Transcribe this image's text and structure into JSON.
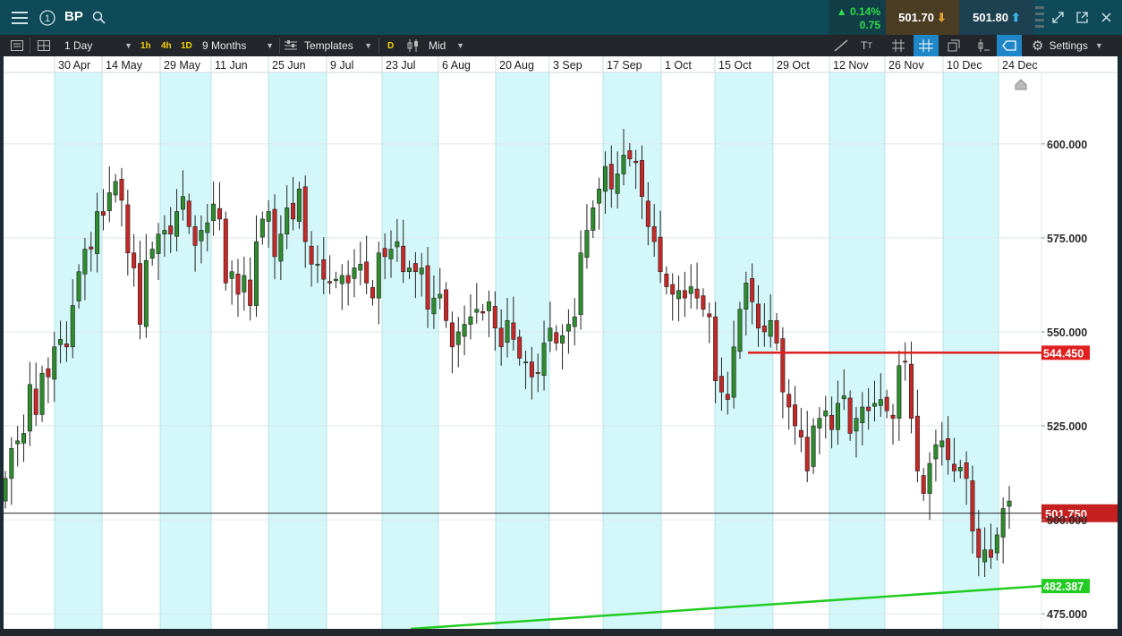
{
  "topbar": {
    "symbol": "BP",
    "change_pct": "▲ 0.14%",
    "change_abs": "0.75",
    "sell_price": "501.70",
    "buy_price": "501.80"
  },
  "toolbar": {
    "interval": "1 Day",
    "quick_intervals": [
      "1h",
      "4h",
      "1D"
    ],
    "range": "9 Months",
    "templates": "Templates",
    "d_badge": "D",
    "price_type": "Mid",
    "settings": "Settings"
  },
  "colors": {
    "up_candle": "#2e8b2e",
    "down_candle": "#c62828",
    "resistance": "#e02020",
    "support": "#22cc22",
    "band": "#d4f8fa",
    "current_price_box": "#c51f1f"
  },
  "chart_data": {
    "type": "candlestick",
    "date_labels": [
      "30 Apr",
      "14 May",
      "29 May",
      "11 Jun",
      "25 Jun",
      "9 Jul",
      "23 Jul",
      "6 Aug",
      "20 Aug",
      "3 Sep",
      "17 Sep",
      "1 Oct",
      "15 Oct",
      "29 Oct",
      "12 Nov",
      "26 Nov",
      "10 Dec",
      "24 Dec"
    ],
    "price_ticks": [
      "600.000",
      "575.000",
      "550.000",
      "525.000",
      "500.000",
      "475.000"
    ],
    "price_tick_values": [
      600,
      575,
      550,
      525,
      500,
      475
    ],
    "ylim": [
      471,
      619
    ],
    "current_price": {
      "value": 501.75,
      "label": "501.750"
    },
    "resistance_line": {
      "value": 544.45,
      "label": "544.450"
    },
    "support_line": {
      "label": "482.387",
      "value_at_last_bar": 482.387,
      "value_at_start_visible": 471.0
    },
    "closes": [
      511,
      519,
      521,
      523,
      536,
      528,
      539,
      538,
      546,
      548,
      546,
      557,
      566,
      572,
      572,
      582,
      581,
      587,
      590,
      585,
      571,
      567,
      552,
      569,
      572,
      576,
      577,
      576,
      582,
      586,
      578,
      573,
      577,
      579,
      584,
      580,
      563,
      566,
      560,
      565,
      557,
      574,
      580,
      582,
      570,
      576,
      583,
      580,
      588,
      574,
      568,
      568,
      564,
      563,
      564,
      565,
      563,
      567,
      568,
      563,
      559,
      571,
      570,
      572,
      574,
      566,
      567,
      566,
      567,
      556,
      559,
      560,
      553,
      546,
      550,
      552,
      554,
      556,
      555,
      558,
      551,
      546,
      553,
      548,
      543,
      542,
      538,
      539,
      547,
      551,
      547,
      549,
      552,
      554,
      571,
      577,
      583,
      588,
      594,
      588,
      592,
      597,
      596,
      595,
      586,
      578,
      574,
      566,
      562,
      560,
      561,
      559,
      562,
      559,
      556,
      554,
      537,
      534,
      532,
      546,
      556,
      563,
      558,
      551,
      550,
      553,
      547,
      534,
      530,
      525,
      522,
      513,
      525,
      527,
      529,
      524,
      531,
      533,
      523,
      527,
      530,
      529,
      531,
      532,
      529,
      527,
      541,
      542,
      527,
      513,
      507,
      515,
      520,
      521,
      516,
      513,
      514,
      511,
      497,
      490,
      492,
      490,
      496,
      503,
      505
    ],
    "source_note": "closes are approximate readings per trading day"
  }
}
